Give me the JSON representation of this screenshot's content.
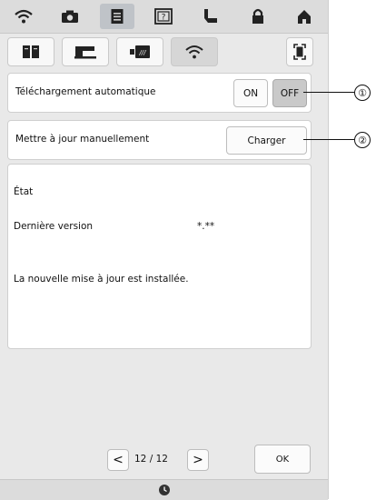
{
  "top_tabs": [
    {
      "icon": "wifi-icon"
    },
    {
      "icon": "camera-icon"
    },
    {
      "icon": "document-icon",
      "active": true
    },
    {
      "icon": "help-icon"
    },
    {
      "icon": "presser-foot-icon"
    },
    {
      "icon": "lock-icon"
    },
    {
      "icon": "home-icon"
    }
  ],
  "sub_tabs": [
    {
      "icon": "book-icon"
    },
    {
      "icon": "sewing-machine-icon"
    },
    {
      "icon": "embroidery-icon"
    },
    {
      "icon": "wifi-icon",
      "active": true
    }
  ],
  "auto_download": {
    "label": "Téléchargement automatique",
    "on_label": "ON",
    "off_label": "OFF",
    "selected": "OFF",
    "callout": "①"
  },
  "manual_update": {
    "label": "Mettre à jour manuellement",
    "button_label": "Charger",
    "callout": "②"
  },
  "status": {
    "title": "État",
    "version_label": "Dernière version",
    "version_value": "*.**",
    "message": "La nouvelle mise à jour est installée."
  },
  "pager": {
    "prev": "<",
    "page": "12 / 12",
    "next": ">"
  },
  "ok_label": "OK",
  "bottom_icon": "clock-icon"
}
